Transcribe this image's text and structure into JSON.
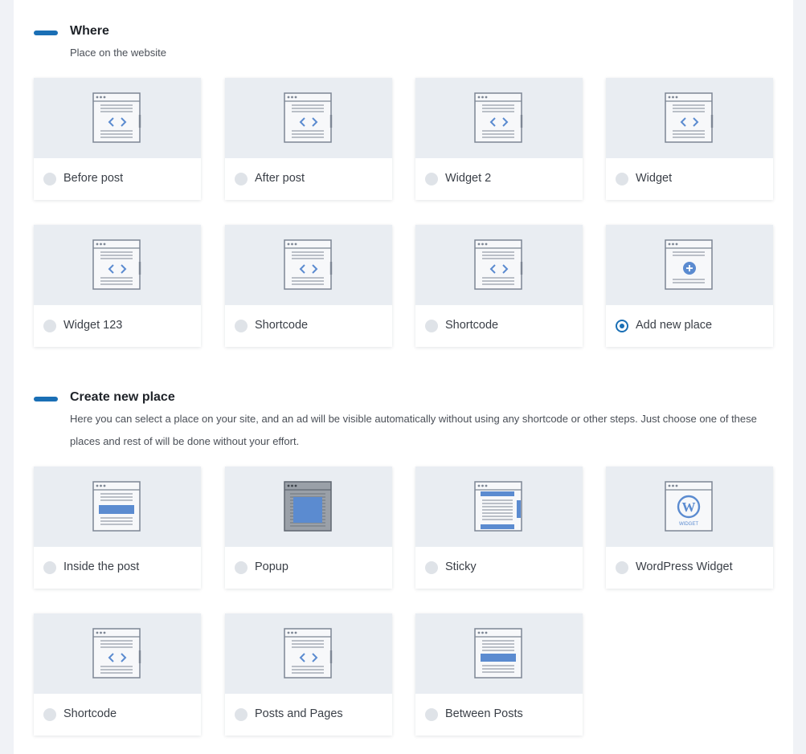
{
  "where": {
    "title": "Where",
    "subtitle": "Place on the website",
    "options": [
      {
        "label": "Before post",
        "icon": "code-icon",
        "selected": false
      },
      {
        "label": "After post",
        "icon": "code-icon",
        "selected": false
      },
      {
        "label": "Widget 2",
        "icon": "code-icon",
        "selected": false
      },
      {
        "label": "Widget",
        "icon": "code-icon",
        "selected": false
      },
      {
        "label": "Widget 123",
        "icon": "code-icon",
        "selected": false
      },
      {
        "label": "Shortcode",
        "icon": "code-icon",
        "selected": false
      },
      {
        "label": "Shortcode",
        "icon": "code-icon",
        "selected": false
      },
      {
        "label": "Add new place",
        "icon": "add-place-icon",
        "selected": true
      }
    ]
  },
  "create": {
    "title": "Create new place",
    "description": "Here you can select a place on your site, and an ad will be visible automatically without using any shortcode or other steps. Just choose one of these places and rest of will be done without your effort.",
    "options": [
      {
        "label": "Inside the post",
        "icon": "inside-post-icon",
        "selected": false
      },
      {
        "label": "Popup",
        "icon": "popup-icon",
        "selected": false
      },
      {
        "label": "Sticky",
        "icon": "sticky-icon",
        "selected": false
      },
      {
        "label": "WordPress Widget",
        "icon": "wordpress-widget-icon",
        "selected": false,
        "icon_text": "WIDGET"
      },
      {
        "label": "Shortcode",
        "icon": "code-icon",
        "selected": false
      },
      {
        "label": "Posts and Pages",
        "icon": "code-icon",
        "selected": false
      },
      {
        "label": "Between Posts",
        "icon": "between-posts-icon",
        "selected": false
      }
    ]
  },
  "colors": {
    "accent": "#1a6fb5",
    "icon_stroke": "#7d8694",
    "icon_fill": "#5b8bd0",
    "thumb_bg": "#e9edf2"
  }
}
